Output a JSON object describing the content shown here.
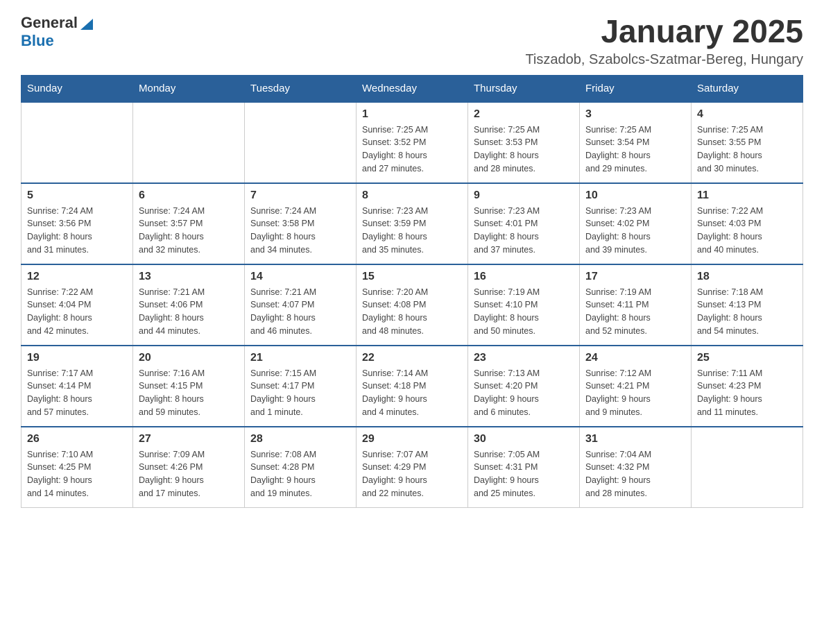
{
  "logo": {
    "text_general": "General",
    "text_blue": "Blue",
    "line2": "Blue"
  },
  "title": "January 2025",
  "subtitle": "Tiszadob, Szabolcs-Szatmar-Bereg, Hungary",
  "days_of_week": [
    "Sunday",
    "Monday",
    "Tuesday",
    "Wednesday",
    "Thursday",
    "Friday",
    "Saturday"
  ],
  "weeks": [
    [
      {
        "day": "",
        "info": ""
      },
      {
        "day": "",
        "info": ""
      },
      {
        "day": "",
        "info": ""
      },
      {
        "day": "1",
        "info": "Sunrise: 7:25 AM\nSunset: 3:52 PM\nDaylight: 8 hours\nand 27 minutes."
      },
      {
        "day": "2",
        "info": "Sunrise: 7:25 AM\nSunset: 3:53 PM\nDaylight: 8 hours\nand 28 minutes."
      },
      {
        "day": "3",
        "info": "Sunrise: 7:25 AM\nSunset: 3:54 PM\nDaylight: 8 hours\nand 29 minutes."
      },
      {
        "day": "4",
        "info": "Sunrise: 7:25 AM\nSunset: 3:55 PM\nDaylight: 8 hours\nand 30 minutes."
      }
    ],
    [
      {
        "day": "5",
        "info": "Sunrise: 7:24 AM\nSunset: 3:56 PM\nDaylight: 8 hours\nand 31 minutes."
      },
      {
        "day": "6",
        "info": "Sunrise: 7:24 AM\nSunset: 3:57 PM\nDaylight: 8 hours\nand 32 minutes."
      },
      {
        "day": "7",
        "info": "Sunrise: 7:24 AM\nSunset: 3:58 PM\nDaylight: 8 hours\nand 34 minutes."
      },
      {
        "day": "8",
        "info": "Sunrise: 7:23 AM\nSunset: 3:59 PM\nDaylight: 8 hours\nand 35 minutes."
      },
      {
        "day": "9",
        "info": "Sunrise: 7:23 AM\nSunset: 4:01 PM\nDaylight: 8 hours\nand 37 minutes."
      },
      {
        "day": "10",
        "info": "Sunrise: 7:23 AM\nSunset: 4:02 PM\nDaylight: 8 hours\nand 39 minutes."
      },
      {
        "day": "11",
        "info": "Sunrise: 7:22 AM\nSunset: 4:03 PM\nDaylight: 8 hours\nand 40 minutes."
      }
    ],
    [
      {
        "day": "12",
        "info": "Sunrise: 7:22 AM\nSunset: 4:04 PM\nDaylight: 8 hours\nand 42 minutes."
      },
      {
        "day": "13",
        "info": "Sunrise: 7:21 AM\nSunset: 4:06 PM\nDaylight: 8 hours\nand 44 minutes."
      },
      {
        "day": "14",
        "info": "Sunrise: 7:21 AM\nSunset: 4:07 PM\nDaylight: 8 hours\nand 46 minutes."
      },
      {
        "day": "15",
        "info": "Sunrise: 7:20 AM\nSunset: 4:08 PM\nDaylight: 8 hours\nand 48 minutes."
      },
      {
        "day": "16",
        "info": "Sunrise: 7:19 AM\nSunset: 4:10 PM\nDaylight: 8 hours\nand 50 minutes."
      },
      {
        "day": "17",
        "info": "Sunrise: 7:19 AM\nSunset: 4:11 PM\nDaylight: 8 hours\nand 52 minutes."
      },
      {
        "day": "18",
        "info": "Sunrise: 7:18 AM\nSunset: 4:13 PM\nDaylight: 8 hours\nand 54 minutes."
      }
    ],
    [
      {
        "day": "19",
        "info": "Sunrise: 7:17 AM\nSunset: 4:14 PM\nDaylight: 8 hours\nand 57 minutes."
      },
      {
        "day": "20",
        "info": "Sunrise: 7:16 AM\nSunset: 4:15 PM\nDaylight: 8 hours\nand 59 minutes."
      },
      {
        "day": "21",
        "info": "Sunrise: 7:15 AM\nSunset: 4:17 PM\nDaylight: 9 hours\nand 1 minute."
      },
      {
        "day": "22",
        "info": "Sunrise: 7:14 AM\nSunset: 4:18 PM\nDaylight: 9 hours\nand 4 minutes."
      },
      {
        "day": "23",
        "info": "Sunrise: 7:13 AM\nSunset: 4:20 PM\nDaylight: 9 hours\nand 6 minutes."
      },
      {
        "day": "24",
        "info": "Sunrise: 7:12 AM\nSunset: 4:21 PM\nDaylight: 9 hours\nand 9 minutes."
      },
      {
        "day": "25",
        "info": "Sunrise: 7:11 AM\nSunset: 4:23 PM\nDaylight: 9 hours\nand 11 minutes."
      }
    ],
    [
      {
        "day": "26",
        "info": "Sunrise: 7:10 AM\nSunset: 4:25 PM\nDaylight: 9 hours\nand 14 minutes."
      },
      {
        "day": "27",
        "info": "Sunrise: 7:09 AM\nSunset: 4:26 PM\nDaylight: 9 hours\nand 17 minutes."
      },
      {
        "day": "28",
        "info": "Sunrise: 7:08 AM\nSunset: 4:28 PM\nDaylight: 9 hours\nand 19 minutes."
      },
      {
        "day": "29",
        "info": "Sunrise: 7:07 AM\nSunset: 4:29 PM\nDaylight: 9 hours\nand 22 minutes."
      },
      {
        "day": "30",
        "info": "Sunrise: 7:05 AM\nSunset: 4:31 PM\nDaylight: 9 hours\nand 25 minutes."
      },
      {
        "day": "31",
        "info": "Sunrise: 7:04 AM\nSunset: 4:32 PM\nDaylight: 9 hours\nand 28 minutes."
      },
      {
        "day": "",
        "info": ""
      }
    ]
  ],
  "colors": {
    "header_bg": "#2a6099",
    "header_text": "#ffffff",
    "border": "#2a6099"
  }
}
